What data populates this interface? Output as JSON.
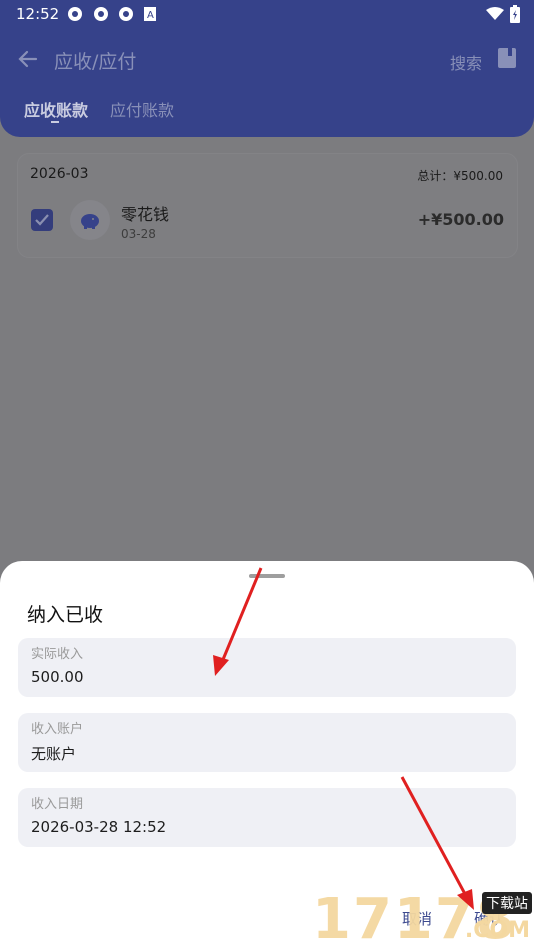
{
  "status_bar": {
    "time": "12:52"
  },
  "header": {
    "title": "应收/应付",
    "search_label": "搜索",
    "tabs": [
      {
        "label": "应收账款",
        "active": true
      },
      {
        "label": "应付账款",
        "active": false
      }
    ]
  },
  "record_group": {
    "month": "2026-03",
    "total": "总计：¥500.00",
    "items": [
      {
        "name": "零花钱",
        "date": "03-28",
        "amount": "+¥500.00",
        "checked": true
      }
    ]
  },
  "dialog": {
    "title": "纳入已收",
    "fields": [
      {
        "label": "实际收入",
        "value": "500.00"
      },
      {
        "label": "收入账户",
        "value": "无账户"
      },
      {
        "label": "收入日期",
        "value": "2026-03-28 12:52"
      }
    ],
    "cancel_label": "取消",
    "confirm_label": "确认"
  },
  "watermark": {
    "number": "17178",
    "tag": "下载站",
    "suffix": ".COM"
  },
  "colors": {
    "primary": "#36428a",
    "accent": "#3c4a8f",
    "field_bg": "#eff0f5",
    "annotation": "#e02020"
  }
}
